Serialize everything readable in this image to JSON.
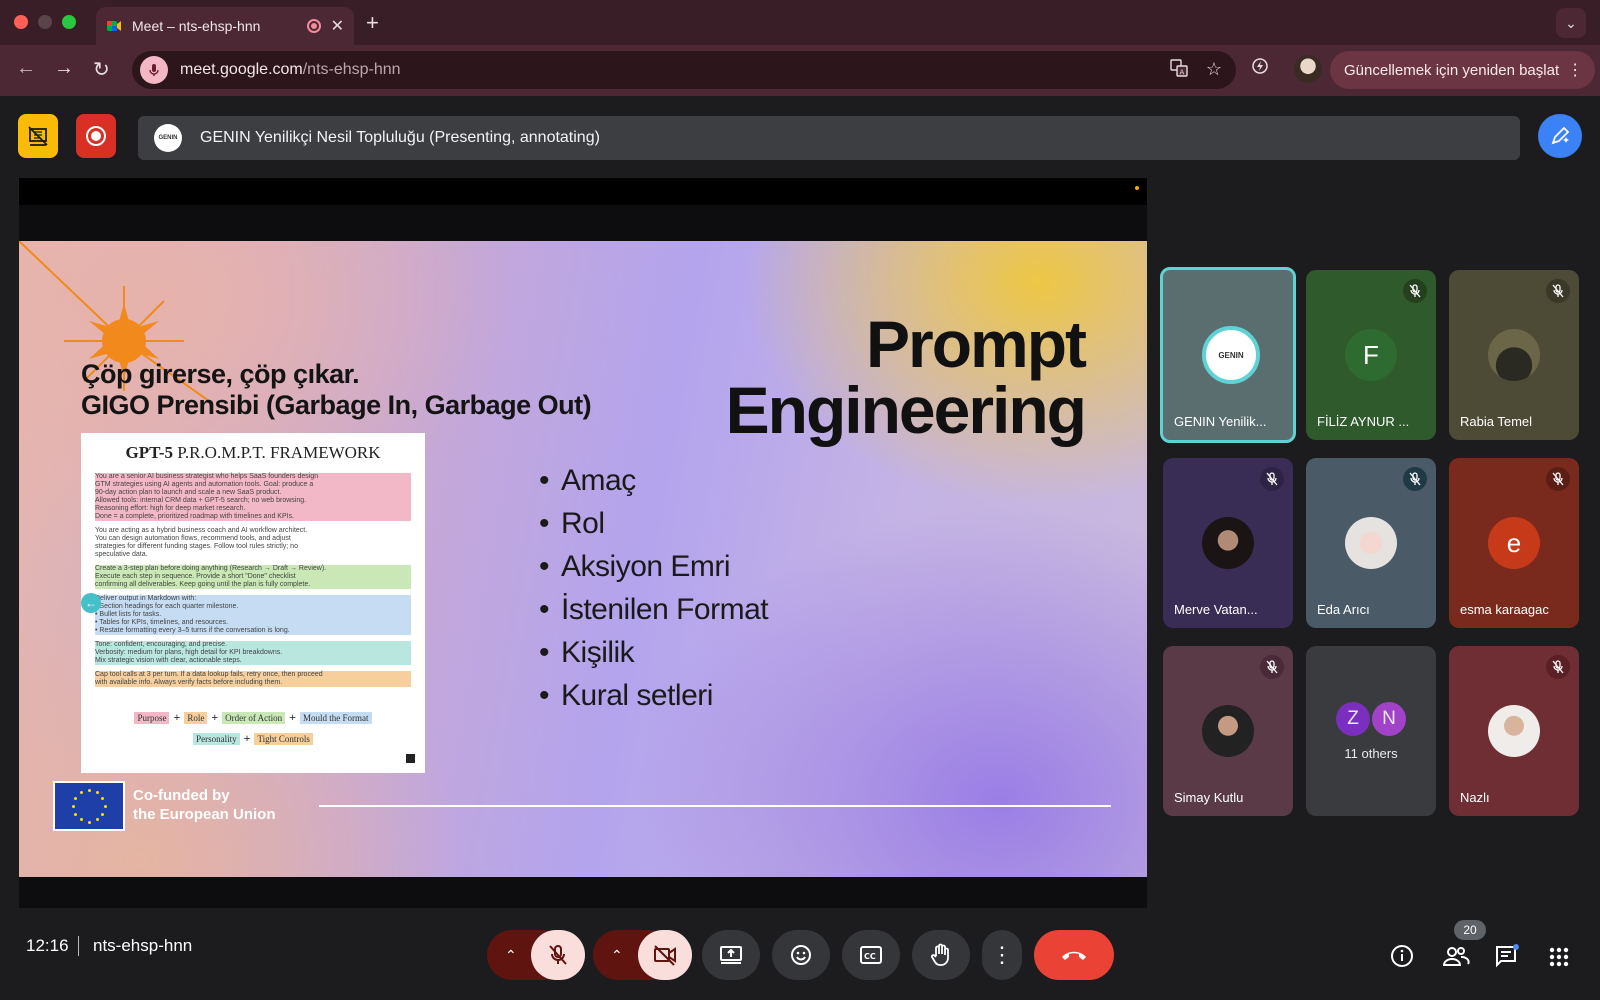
{
  "browser": {
    "tab_title": "Meet – nts-ehsp-hnn",
    "url_host": "meet.google.com",
    "url_path": "/nts-ehsp-hnn",
    "update_label": "Güncellemek için yeniden başlat"
  },
  "meet": {
    "presenter_bar": "GENIN Yenilikçi Nesil Topluluğu (Presenting, annotating)",
    "presenter_logo": "GENIN"
  },
  "slide": {
    "heading_line1": "Çöp girerse, çöp çıkar.",
    "heading_line2": "GIGO Prensibi (Garbage In, Garbage Out)",
    "title_line1": "Prompt",
    "title_line2": "Engineering",
    "bullets": [
      "Amaç",
      "Rol",
      "Aksiyon Emri",
      "İstenilen Format",
      "Kişilik",
      "Kural setleri"
    ],
    "eu_line1": "Co-funded by",
    "eu_line2": "the European Union",
    "framework": {
      "title_bold": "GPT-5",
      "title_rest": " P.R.O.M.P.T. FRAMEWORK",
      "blocks": [
        {
          "color": "pink",
          "lines": [
            "You are a senior AI business strategist who helps SaaS founders design",
            "GTM strategies using AI agents and automation tools. Goal: produce a",
            "90-day action plan to launch and scale a new SaaS product.",
            "Allowed tools: internal CRM data + GPT-5 search; no web browsing.",
            "Reasoning effort: high for deep market research.",
            "Done = a complete, prioritized roadmap with timelines and KPIs."
          ]
        },
        {
          "color": "none",
          "lines": [
            "You are acting as a hybrid business coach and AI workflow architect.",
            "You can design automation flows, recommend tools, and adjust",
            "strategies for different funding stages. Follow tool rules strictly; no",
            "speculative data."
          ]
        },
        {
          "color": "green",
          "lines": [
            "Create a 3-step plan before doing anything (Research → Draft → Review).",
            "Execute each step in sequence. Provide a short \"Done\" checklist",
            "confirming all deliverables. Keep going until the plan is fully complete."
          ]
        },
        {
          "color": "blue",
          "lines": [
            "Deliver output in Markdown with:",
            "• Section headings for each quarter milestone.",
            "• Bullet lists for tasks.",
            "• Tables for KPIs, timelines, and resources.",
            "• Restate formatting every 3–5 turns if the conversation is long."
          ]
        },
        {
          "color": "teal",
          "lines": [
            "Tone: confident, encouraging, and precise.",
            "Verbosity: medium for plans, high detail for KPI breakdowns.",
            "Mix strategic vision with clear, actionable steps."
          ]
        },
        {
          "color": "orange",
          "lines": [
            "Cap tool calls at 3 per turn. If a data lookup fails, retry once, then proceed",
            "with available info. Always verify facts before including them."
          ]
        }
      ],
      "tags": [
        "Purpose",
        "Role",
        "Order of Action",
        "Mould the Format",
        "Personality",
        "Tight Controls"
      ]
    }
  },
  "participants": [
    {
      "name": "GENIN Yenilik...",
      "bg": "#5a6e70",
      "avatar": "GENIN",
      "muted": false,
      "active": true
    },
    {
      "name": "FİLİZ AYNUR ...",
      "bg": "#2f5a2c",
      "avatar": "F",
      "avatar_bg": "#2e6b30",
      "muted": true
    },
    {
      "name": "Rabia Temel",
      "bg": "#4d4a36",
      "avatar": "",
      "muted": true
    },
    {
      "name": "Merve Vatan...",
      "bg": "#3a2d55",
      "avatar": "",
      "muted": true
    },
    {
      "name": "Eda Arıcı",
      "bg": "#4a5a66",
      "avatar": "",
      "muted": true
    },
    {
      "name": "esma karaagac",
      "bg": "#7a2a1c",
      "avatar": "e",
      "avatar_bg": "#c63a1a",
      "muted": true
    },
    {
      "name": "Simay Kutlu",
      "bg": "#5b3a48",
      "avatar": "",
      "muted": true
    },
    {
      "name": "Nazlı",
      "bg": "#6e2e34",
      "avatar": "",
      "muted": true
    }
  ],
  "others": {
    "label": "11 others",
    "initials": [
      "Z",
      "N"
    ]
  },
  "bottom": {
    "time": "12:16",
    "code": "nts-ehsp-hnn",
    "people_count": "20"
  }
}
